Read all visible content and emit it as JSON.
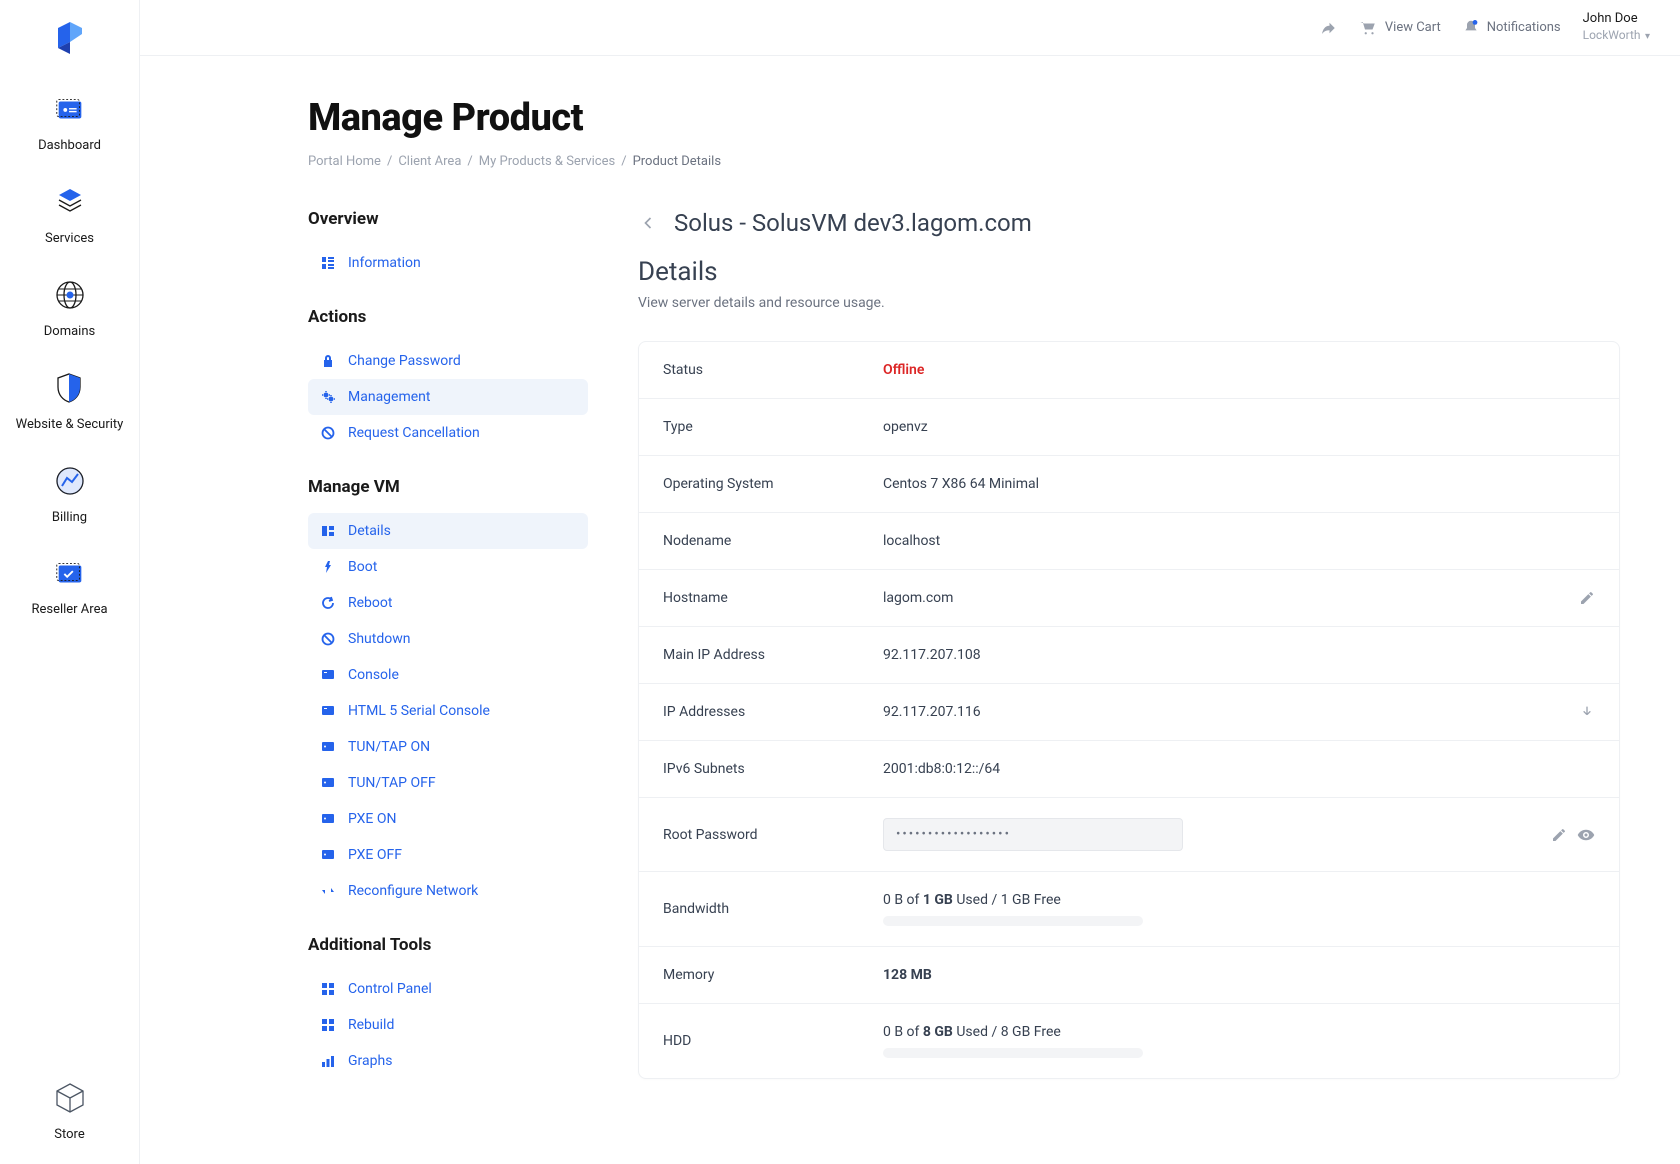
{
  "topbar": {
    "view_cart": "View Cart",
    "notifications": "Notifications",
    "user_name": "John Doe",
    "user_org": "LockWorth"
  },
  "nav": [
    {
      "label": "Dashboard"
    },
    {
      "label": "Services"
    },
    {
      "label": "Domains"
    },
    {
      "label": "Website & Security"
    },
    {
      "label": "Billing"
    },
    {
      "label": "Reseller Area"
    }
  ],
  "nav_bottom": {
    "label": "Store"
  },
  "page": {
    "title": "Manage Product",
    "breadcrumb": [
      "Portal Home",
      "Client Area",
      "My Products & Services",
      "Product Details"
    ]
  },
  "side": {
    "groups": [
      {
        "title": "Overview",
        "items": [
          {
            "label": "Information",
            "active": false
          }
        ]
      },
      {
        "title": "Actions",
        "items": [
          {
            "label": "Change Password",
            "active": false
          },
          {
            "label": "Management",
            "active": true
          },
          {
            "label": "Request Cancellation",
            "active": false
          }
        ]
      },
      {
        "title": "Manage VM",
        "items": [
          {
            "label": "Details",
            "active": true
          },
          {
            "label": "Boot",
            "active": false
          },
          {
            "label": "Reboot",
            "active": false
          },
          {
            "label": "Shutdown",
            "active": false
          },
          {
            "label": "Console",
            "active": false
          },
          {
            "label": "HTML 5 Serial Console",
            "active": false
          },
          {
            "label": "TUN/TAP ON",
            "active": false
          },
          {
            "label": "TUN/TAP OFF",
            "active": false
          },
          {
            "label": "PXE ON",
            "active": false
          },
          {
            "label": "PXE OFF",
            "active": false
          },
          {
            "label": "Reconfigure Network",
            "active": false
          }
        ]
      },
      {
        "title": "Additional Tools",
        "items": [
          {
            "label": "Control Panel",
            "active": false
          },
          {
            "label": "Rebuild",
            "active": false
          },
          {
            "label": "Graphs",
            "active": false
          }
        ]
      }
    ]
  },
  "detail": {
    "heading": "Solus - SolusVM dev3.lagom.com",
    "section_title": "Details",
    "section_sub": "View server details and resource usage.",
    "rows": {
      "status_label": "Status",
      "status_value": "Offline",
      "type_label": "Type",
      "type_value": "openvz",
      "os_label": "Operating System",
      "os_value": "Centos 7 X86 64 Minimal",
      "node_label": "Nodename",
      "node_value": "localhost",
      "host_label": "Hostname",
      "host_value": "lagom.com",
      "ip_label": "Main IP Address",
      "ip_value": "92.117.207.108",
      "ips_label": "IP Addresses",
      "ips_value": "92.117.207.116",
      "ipv6_label": "IPv6 Subnets",
      "ipv6_value": "2001:db8:0:12::/64",
      "root_label": "Root Password",
      "root_value": "••••••••••••••••••",
      "bw_label": "Bandwidth",
      "bw_prefix": "0 B of ",
      "bw_bold": "1 GB",
      "bw_suffix": " Used / 1 GB Free",
      "mem_label": "Memory",
      "mem_value": "128 MB",
      "hdd_label": "HDD",
      "hdd_prefix": "0 B of ",
      "hdd_bold": "8 GB",
      "hdd_suffix": " Used / 8 GB Free"
    }
  }
}
